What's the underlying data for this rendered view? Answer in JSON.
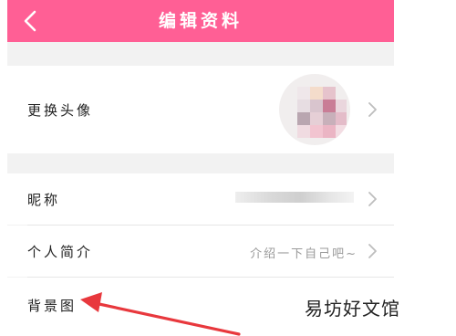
{
  "header": {
    "title": "编辑资料",
    "back_icon": "chevron-left-icon"
  },
  "rows": {
    "avatar": {
      "label": "更换头像"
    },
    "nickname": {
      "label": "昵称"
    },
    "intro": {
      "label": "个人简介",
      "value": "介绍一下自己吧~"
    },
    "background": {
      "label": "背景图"
    }
  },
  "watermark": {
    "text": "易坊好文馆"
  },
  "colors": {
    "accent": "#ff5f95",
    "arrow": "#e8383d",
    "page_bg": "#f2f2f2"
  }
}
